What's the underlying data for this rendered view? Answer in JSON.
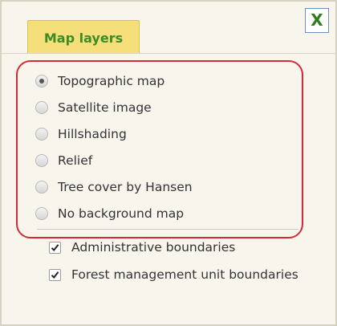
{
  "dialog": {
    "close_label": "X",
    "tab_label": "Map layers"
  },
  "base_maps": {
    "selected": "Topographic map",
    "options": [
      {
        "label": "Topographic map",
        "checked": true
      },
      {
        "label": "Satellite image",
        "checked": false
      },
      {
        "label": "Hillshading",
        "checked": false
      },
      {
        "label": "Relief",
        "checked": false
      },
      {
        "label": "Tree cover by Hansen",
        "checked": false
      },
      {
        "label": "No background map",
        "checked": false
      }
    ]
  },
  "overlays": [
    {
      "label": "Administrative boundaries",
      "checked": true
    },
    {
      "label": "Forest management unit boundaries",
      "checked": true
    }
  ],
  "colors": {
    "accent_green": "#3d8c25",
    "tab_yellow": "#f5df7a",
    "highlight_red": "#d42a36",
    "close_border": "#6b8fc2"
  }
}
